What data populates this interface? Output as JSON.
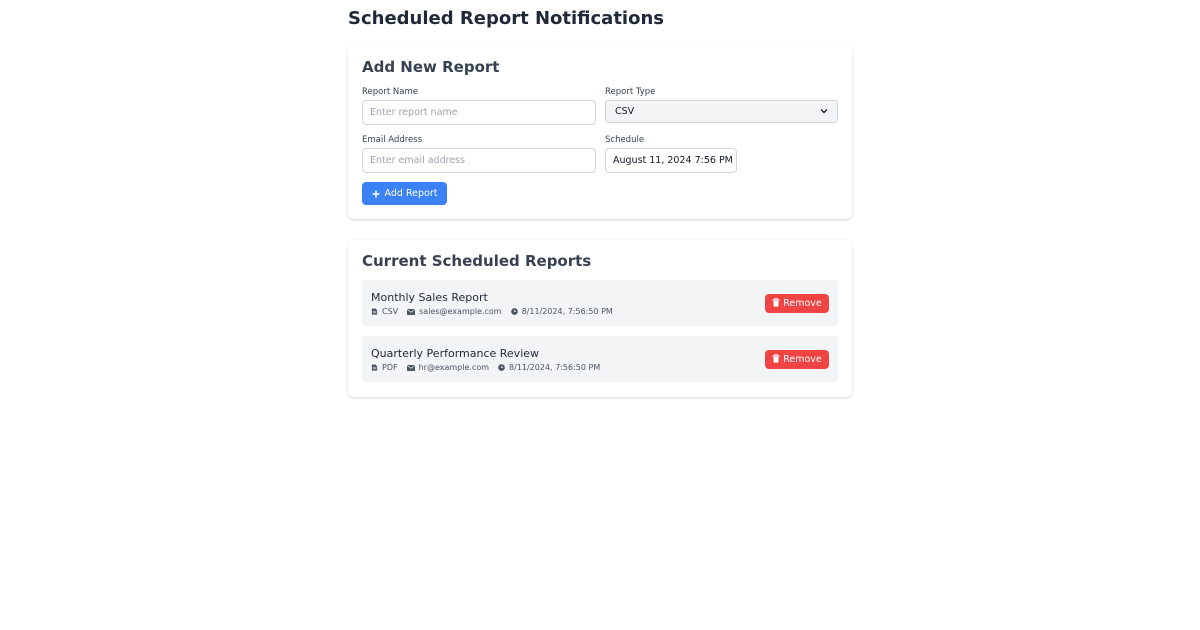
{
  "page": {
    "title": "Scheduled Report Notifications"
  },
  "add_form": {
    "title": "Add New Report",
    "report_name": {
      "label": "Report Name",
      "placeholder": "Enter report name",
      "value": ""
    },
    "report_type": {
      "label": "Report Type",
      "value": "CSV"
    },
    "email": {
      "label": "Email Address",
      "placeholder": "Enter email address",
      "value": ""
    },
    "schedule": {
      "label": "Schedule",
      "value": "August 11, 2024 7:56 PM"
    },
    "submit_label": "Add Report",
    "icons": {
      "add": "plus-icon",
      "dropdown": "chevron-down-icon"
    }
  },
  "report_list": {
    "title": "Current Scheduled Reports",
    "remove_label": "Remove",
    "icons": {
      "type": "file-icon",
      "email": "envelope-icon",
      "time": "clock-icon",
      "remove": "trash-icon"
    },
    "items": [
      {
        "name": "Monthly Sales Report",
        "type": "CSV",
        "email": "sales@example.com",
        "time": "8/11/2024, 7:56:50 PM"
      },
      {
        "name": "Quarterly Performance Review",
        "type": "PDF",
        "email": "hr@example.com",
        "time": "8/11/2024, 7:56:50 PM"
      }
    ]
  },
  "colors": {
    "primary": "#3b82f6",
    "danger": "#ef4444",
    "item_bg": "#f3f4f6",
    "heading": "#1f2937"
  }
}
